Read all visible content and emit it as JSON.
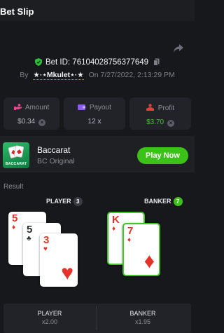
{
  "header": {
    "title": "Bet Slip"
  },
  "bet": {
    "id_text": "Bet ID: 76104028756377649",
    "by_label": "By",
    "username": "★·⋆Mkulet⋆·★",
    "on_label": "On",
    "timestamp": "7/27/2022, 2:13:29 PM"
  },
  "stats": {
    "amount": {
      "label": "Amount",
      "value": "$0.34"
    },
    "payout": {
      "label": "Payout",
      "value": "12 x"
    },
    "profit": {
      "label": "Profit",
      "value": "$3.70"
    }
  },
  "game": {
    "name": "Baccarat",
    "provider": "BC Original",
    "thumb_caption": "BACCARAT",
    "play_label": "Play Now"
  },
  "result": {
    "label": "Result",
    "player": {
      "name": "PLAYER",
      "score": "3",
      "cards": [
        {
          "rank": "5",
          "suit": "♦",
          "color": "red"
        },
        {
          "rank": "5",
          "suit": "♣",
          "color": "black"
        },
        {
          "rank": "3",
          "suit": "♥",
          "color": "red"
        }
      ]
    },
    "banker": {
      "name": "BANKER",
      "score": "7",
      "cards": [
        {
          "rank": "K",
          "suit": "♦",
          "color": "red"
        },
        {
          "rank": "7",
          "suit": "♦",
          "color": "red"
        }
      ]
    }
  },
  "odds": {
    "player": {
      "name": "PLAYER",
      "multiplier": "x2.00"
    },
    "banker": {
      "name": "BANKER",
      "multiplier": "x1.95"
    }
  },
  "colors": {
    "accent_green": "#3bc117",
    "banker_badge": "#3bc117",
    "player_badge": "#3a3c43",
    "card_red": "#e5332a"
  }
}
